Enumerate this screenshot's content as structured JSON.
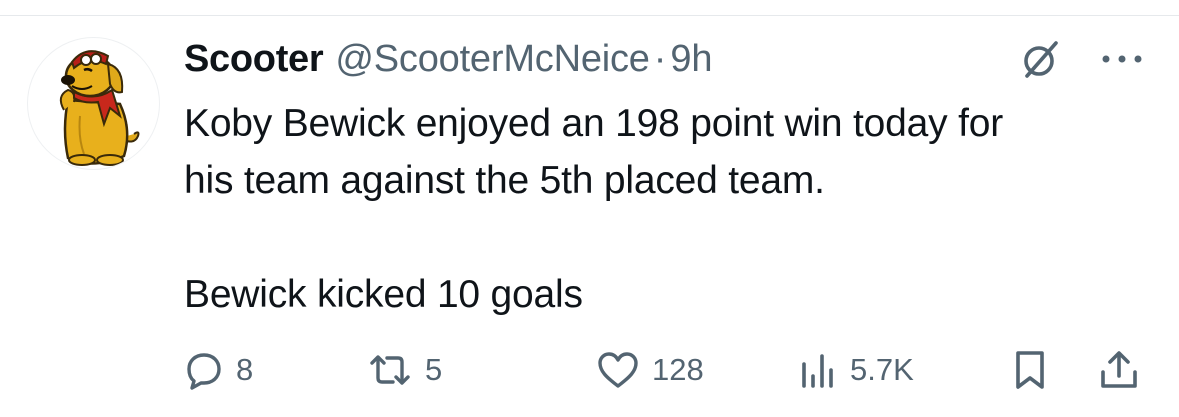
{
  "tweet": {
    "author": {
      "display_name": "Scooter",
      "handle": "@ScooterMcNeice",
      "separator": "·",
      "time": "9h",
      "avatar_icon": "cartoon-dog-avatar"
    },
    "text": "Koby Bewick enjoyed an 198 point win today for\nhis team against the 5th placed team.\n\nBewick kicked 10 goals",
    "stats": {
      "replies": "8",
      "reposts": "5",
      "likes": "128",
      "views": "5.7K"
    },
    "icons": {
      "grok": "grok-icon",
      "more": "more-dots-icon",
      "reply": "reply-bubble-icon",
      "repost": "repost-arrows-icon",
      "like": "heart-icon",
      "views": "views-bars-icon",
      "bookmark": "bookmark-icon",
      "share": "share-upload-icon"
    },
    "colors": {
      "text": "#0f1419",
      "secondary": "#536471",
      "divider": "#e6e9ec"
    }
  }
}
